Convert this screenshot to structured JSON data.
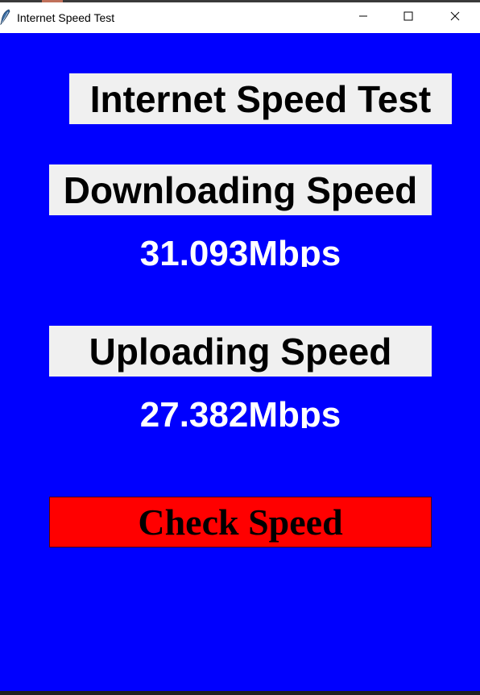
{
  "window": {
    "title": "Internet Speed Test"
  },
  "header": {
    "title": "Internet Speed Test"
  },
  "download": {
    "label": "Downloading Speed",
    "value": "31.093Mbps"
  },
  "upload": {
    "label": "Uploading Speed",
    "value": "27.382Mbps"
  },
  "actions": {
    "check_label": "Check Speed"
  },
  "colors": {
    "background": "#0000ff",
    "label_background": "#f0f0f0",
    "value_text": "#ffffff",
    "button_background": "#ff0000"
  },
  "icons": {
    "app": "feather-icon",
    "minimize": "minimize-icon",
    "maximize": "maximize-icon",
    "close": "close-icon"
  }
}
